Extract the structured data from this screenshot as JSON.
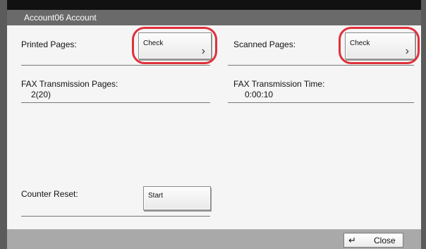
{
  "window": {
    "title": "Account06 Account"
  },
  "counters": {
    "printed_pages": {
      "label": "Printed Pages:",
      "button_label": "Check"
    },
    "scanned_pages": {
      "label": "Scanned Pages:",
      "button_label": "Check"
    },
    "fax_transmission_pages": {
      "label": "FAX Transmission Pages:",
      "value": "2(20)"
    },
    "fax_transmission_time": {
      "label": "FAX Transmission Time:",
      "value": "0:00:10"
    },
    "counter_reset": {
      "label": "Counter Reset:",
      "button_label": "Start"
    }
  },
  "footer": {
    "close_label": "Close"
  },
  "icons": {
    "chevron": "chevron-right-icon",
    "enter": "enter-icon"
  },
  "colors": {
    "highlight_ring": "#e0303a",
    "title_bar": "#6a6a6a",
    "footer": "#a9a9a9"
  }
}
